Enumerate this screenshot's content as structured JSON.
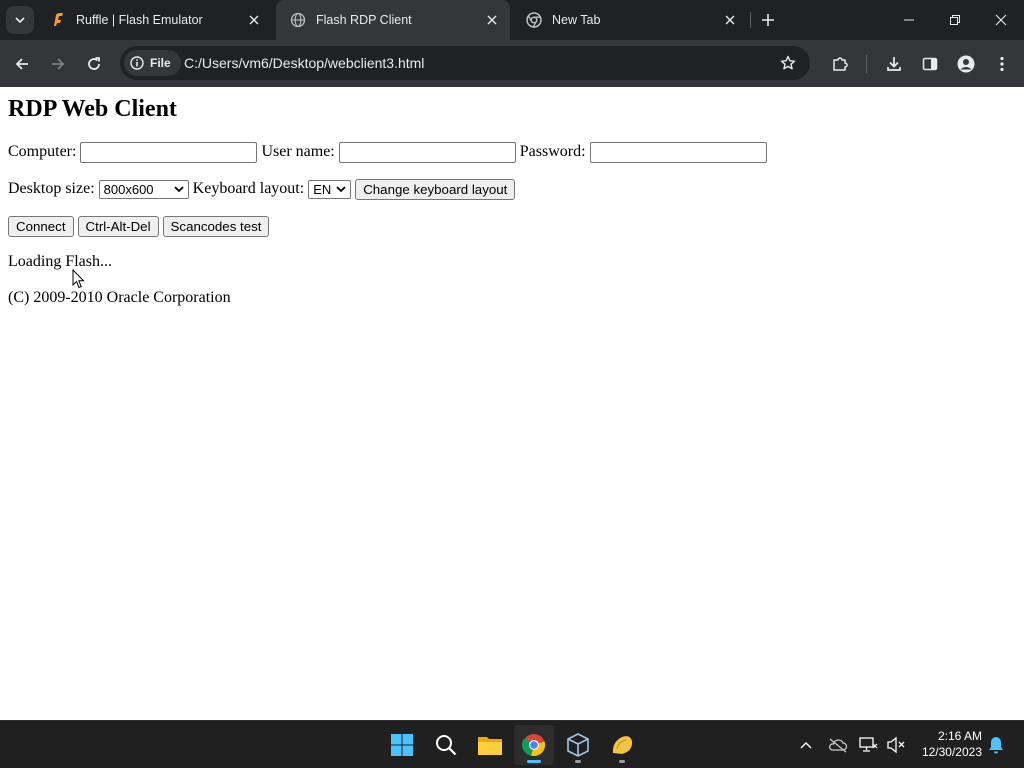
{
  "browser": {
    "tabs": [
      {
        "title": "Ruffle | Flash Emulator",
        "icon": "ruffle-icon",
        "active": false
      },
      {
        "title": "Flash RDP Client",
        "icon": "globe-icon",
        "active": true
      },
      {
        "title": "New Tab",
        "icon": "chrome-icon",
        "active": false
      }
    ],
    "address_chip": "File",
    "url": "C:/Users/vm6/Desktop/webclient3.html"
  },
  "page": {
    "heading": "RDP Web Client",
    "computer_label": "Computer:",
    "computer_value": "",
    "username_label": "User name:",
    "username_value": "",
    "password_label": "Password:",
    "password_value": "",
    "desktop_size_label": "Desktop size:",
    "desktop_size_value": "800x600",
    "keyboard_layout_label": "Keyboard layout:",
    "keyboard_layout_value": "EN",
    "change_keyboard_button": "Change keyboard layout",
    "connect_button": "Connect",
    "ctrl_alt_del_button": "Ctrl-Alt-Del",
    "scancodes_button": "Scancodes test",
    "status": "Loading Flash...",
    "copyright": "(C) 2009-2010 Oracle Corporation"
  },
  "taskbar": {
    "apps": [
      "start-icon",
      "search-icon",
      "file-explorer-icon",
      "chrome-icon",
      "virtualbox-icon",
      "flash-player-icon"
    ],
    "time": "2:16 AM",
    "date": "12/30/2023"
  },
  "colors": {
    "chrome_dark": "#202124",
    "chrome_toolbar": "#35363a",
    "accent_blue": "#4cc2ff"
  }
}
